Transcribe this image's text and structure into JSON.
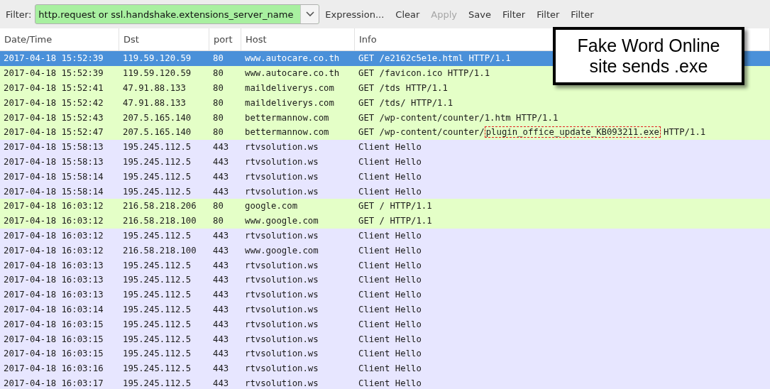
{
  "toolbar": {
    "filter_label": "Filter:",
    "filter_value": "http.request or ssl.handshake.extensions_server_name",
    "buttons": [
      {
        "label": "Expression...",
        "disabled": false
      },
      {
        "label": "Clear",
        "disabled": false
      },
      {
        "label": "Apply",
        "disabled": true
      },
      {
        "label": "Save",
        "disabled": false
      },
      {
        "label": "Filter",
        "disabled": false
      },
      {
        "label": "Filter",
        "disabled": false
      },
      {
        "label": "Filter",
        "disabled": false
      }
    ]
  },
  "table": {
    "columns": [
      "Date/Time",
      "Dst",
      "port",
      "Host",
      "Info"
    ],
    "rows": [
      {
        "kind": "http",
        "selected": true,
        "cells": [
          "2017-04-18 15:52:39",
          "119.59.120.59",
          "80",
          "www.autocare.co.th",
          "GET /e2162c5e1e.html HTTP/1.1"
        ]
      },
      {
        "kind": "http",
        "selected": false,
        "cells": [
          "2017-04-18 15:52:39",
          "119.59.120.59",
          "80",
          "www.autocare.co.th",
          "GET /favicon.ico HTTP/1.1"
        ]
      },
      {
        "kind": "http",
        "selected": false,
        "cells": [
          "2017-04-18 15:52:41",
          "47.91.88.133",
          "80",
          "maildeliverys.com",
          "GET /tds HTTP/1.1"
        ]
      },
      {
        "kind": "http",
        "selected": false,
        "cells": [
          "2017-04-18 15:52:42",
          "47.91.88.133",
          "80",
          "maildeliverys.com",
          "GET /tds/ HTTP/1.1"
        ]
      },
      {
        "kind": "http",
        "selected": false,
        "cells": [
          "2017-04-18 15:52:43",
          "207.5.165.140",
          "80",
          "bettermannow.com",
          "GET /wp-content/counter/1.htm HTTP/1.1"
        ]
      },
      {
        "kind": "http",
        "selected": false,
        "cells": [
          "2017-04-18 15:52:47",
          "207.5.165.140",
          "80",
          "bettermannow.com",
          "GET /wp-content/counter/"
        ],
        "marked": "plugin_office_update_KB093211.exe",
        "after": "HTTP/1.1"
      },
      {
        "kind": "tls",
        "selected": false,
        "cells": [
          "2017-04-18 15:58:13",
          "195.245.112.5",
          "443",
          "rtvsolution.ws",
          "Client Hello"
        ]
      },
      {
        "kind": "tls",
        "selected": false,
        "cells": [
          "2017-04-18 15:58:13",
          "195.245.112.5",
          "443",
          "rtvsolution.ws",
          "Client Hello"
        ]
      },
      {
        "kind": "tls",
        "selected": false,
        "cells": [
          "2017-04-18 15:58:14",
          "195.245.112.5",
          "443",
          "rtvsolution.ws",
          "Client Hello"
        ]
      },
      {
        "kind": "tls",
        "selected": false,
        "cells": [
          "2017-04-18 15:58:14",
          "195.245.112.5",
          "443",
          "rtvsolution.ws",
          "Client Hello"
        ]
      },
      {
        "kind": "http",
        "selected": false,
        "cells": [
          "2017-04-18 16:03:12",
          "216.58.218.206",
          "80",
          "google.com",
          "GET / HTTP/1.1"
        ]
      },
      {
        "kind": "http",
        "selected": false,
        "cells": [
          "2017-04-18 16:03:12",
          "216.58.218.100",
          "80",
          "www.google.com",
          "GET / HTTP/1.1"
        ]
      },
      {
        "kind": "tls",
        "selected": false,
        "cells": [
          "2017-04-18 16:03:12",
          "195.245.112.5",
          "443",
          "rtvsolution.ws",
          "Client Hello"
        ]
      },
      {
        "kind": "tls",
        "selected": false,
        "cells": [
          "2017-04-18 16:03:12",
          "216.58.218.100",
          "443",
          "www.google.com",
          "Client Hello"
        ]
      },
      {
        "kind": "tls",
        "selected": false,
        "cells": [
          "2017-04-18 16:03:13",
          "195.245.112.5",
          "443",
          "rtvsolution.ws",
          "Client Hello"
        ]
      },
      {
        "kind": "tls",
        "selected": false,
        "cells": [
          "2017-04-18 16:03:13",
          "195.245.112.5",
          "443",
          "rtvsolution.ws",
          "Client Hello"
        ]
      },
      {
        "kind": "tls",
        "selected": false,
        "cells": [
          "2017-04-18 16:03:13",
          "195.245.112.5",
          "443",
          "rtvsolution.ws",
          "Client Hello"
        ]
      },
      {
        "kind": "tls",
        "selected": false,
        "cells": [
          "2017-04-18 16:03:14",
          "195.245.112.5",
          "443",
          "rtvsolution.ws",
          "Client Hello"
        ]
      },
      {
        "kind": "tls",
        "selected": false,
        "cells": [
          "2017-04-18 16:03:15",
          "195.245.112.5",
          "443",
          "rtvsolution.ws",
          "Client Hello"
        ]
      },
      {
        "kind": "tls",
        "selected": false,
        "cells": [
          "2017-04-18 16:03:15",
          "195.245.112.5",
          "443",
          "rtvsolution.ws",
          "Client Hello"
        ]
      },
      {
        "kind": "tls",
        "selected": false,
        "cells": [
          "2017-04-18 16:03:15",
          "195.245.112.5",
          "443",
          "rtvsolution.ws",
          "Client Hello"
        ]
      },
      {
        "kind": "tls",
        "selected": false,
        "cells": [
          "2017-04-18 16:03:16",
          "195.245.112.5",
          "443",
          "rtvsolution.ws",
          "Client Hello"
        ]
      },
      {
        "kind": "tls",
        "selected": false,
        "cells": [
          "2017-04-18 16:03:17",
          "195.245.112.5",
          "443",
          "rtvsolution.ws",
          "Client Hello"
        ]
      }
    ]
  },
  "callout": {
    "lines": [
      "Fake Word Online",
      "site sends .exe"
    ]
  }
}
